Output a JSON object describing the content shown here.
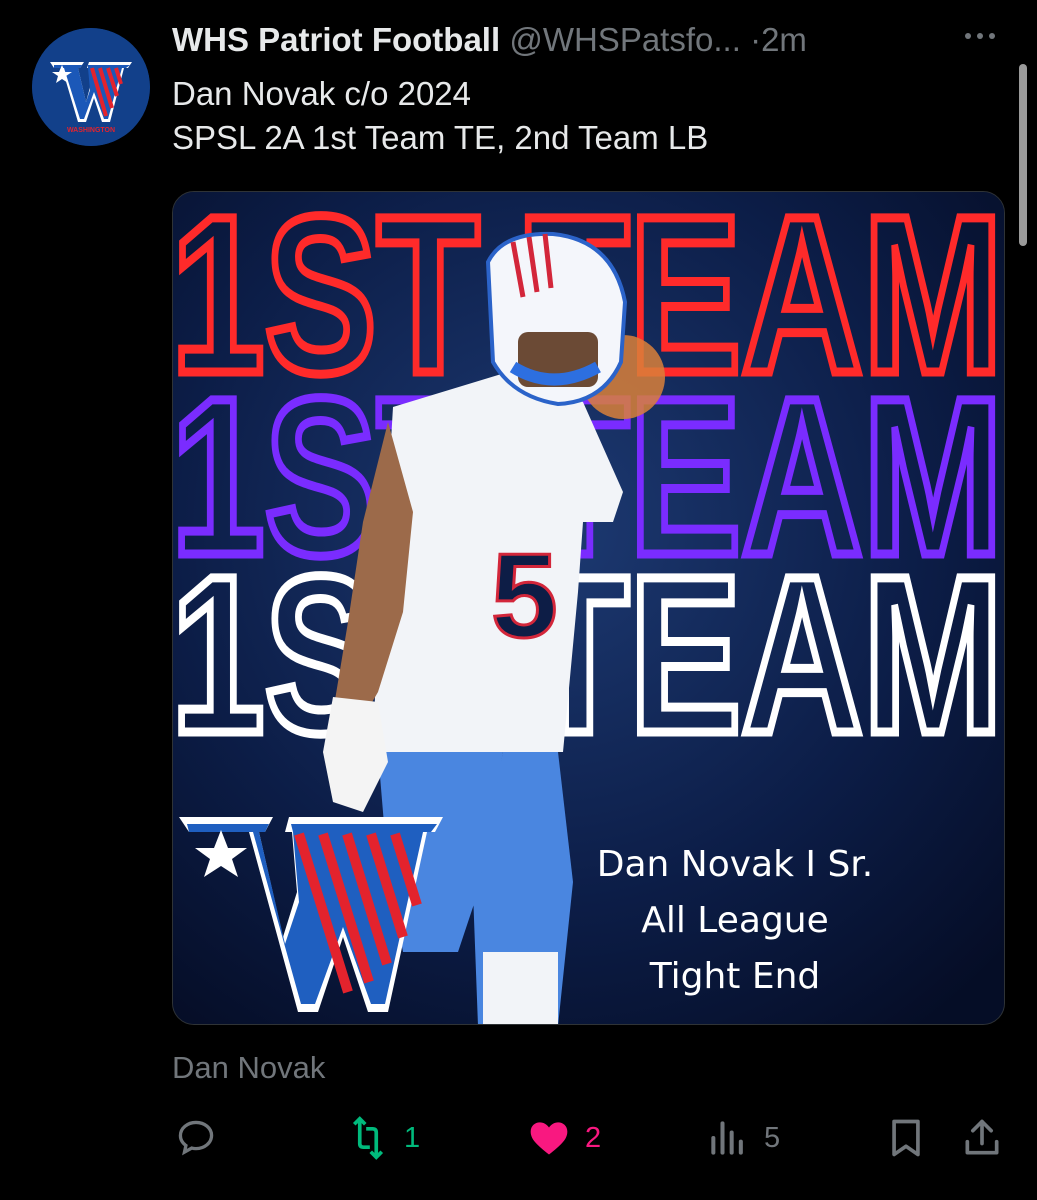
{
  "account": {
    "display_name": "WHS Patriot Football",
    "handle": "@WHSPatsfo...",
    "separator": "·",
    "time": "2m",
    "avatar_text": "WASHINGTON"
  },
  "tweet": {
    "lines": [
      "Dan Novak c/o 2024",
      "SPSL 2A 1st Team TE, 2nd Team LB"
    ]
  },
  "media": {
    "banner_rows": [
      "1ST TEAM",
      "1ST TEAM",
      "1ST TEAM"
    ],
    "player_jersey_number": "5",
    "award_lines": [
      "Dan Novak I Sr.",
      "All League",
      "Tight End"
    ]
  },
  "caption": "Dan Novak",
  "actions": {
    "reply_count": "",
    "retweet_count": "1",
    "like_count": "2",
    "view_count": "5"
  },
  "colors": {
    "retweet_green": "#00ba7c",
    "like_pink": "#f91880",
    "muted_gray": "#71767b",
    "banner_red": "#ff2a2a",
    "banner_purple": "#7a2cff",
    "banner_white": "#ffffff"
  }
}
